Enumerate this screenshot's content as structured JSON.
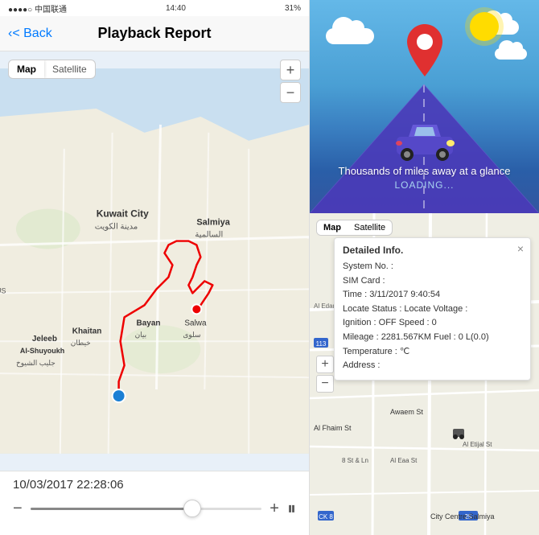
{
  "statusBar": {
    "time": "14:40",
    "signal": "●●●●○",
    "battery": "31%"
  },
  "navBar": {
    "backLabel": "< Back",
    "title": "Playback Report"
  },
  "mapControls": {
    "mapType1": "Map",
    "mapType2": "Satellite",
    "zoomIn": "+",
    "zoomOut": "−"
  },
  "bottomBar": {
    "timestamp": "10/03/2017 22:28:06",
    "minus": "−",
    "plus": "+"
  },
  "illustration": {
    "mainText": "Thousands of miles away at a glance",
    "loadingText": "LOADING..."
  },
  "detailMapControls": {
    "mapType1": "Map",
    "mapType2": "Satellite",
    "zoomIn": "+",
    "zoomOut": "−"
  },
  "infoPopup": {
    "title": "Detailed Info.",
    "systemNo": "System No. :",
    "simCard": "SIM Card :",
    "time": "Time : 3/11/2017 9:40:54",
    "locateStatus": "Locate Status : Locate Voltage :",
    "ignition": "Ignition : OFF Speed : 0",
    "mileage": "Mileage : 2281.567KM Fuel : 0 L(0.0)",
    "temperature": "Temperature : ℃",
    "address": "Address :",
    "close": "×"
  }
}
